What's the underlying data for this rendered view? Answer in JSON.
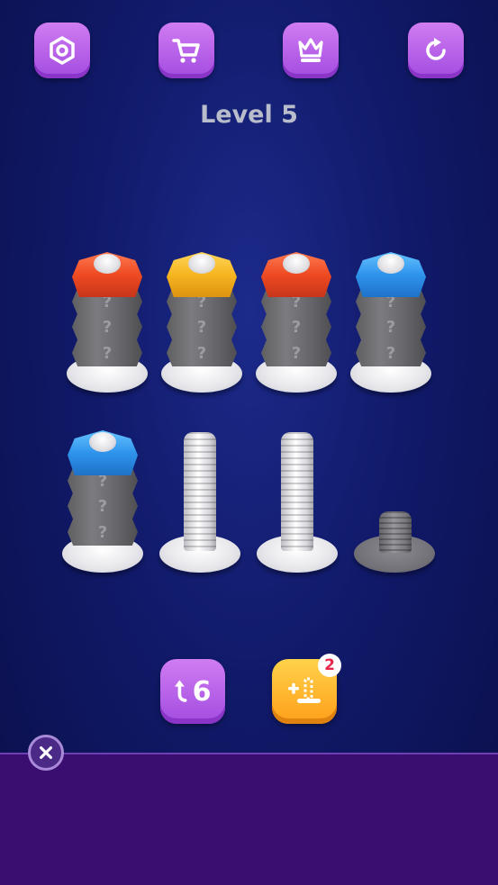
{
  "toolbar": {
    "buttons": [
      {
        "name": "settings",
        "icon": "hex-nut-icon"
      },
      {
        "name": "shop",
        "icon": "cart-icon"
      },
      {
        "name": "crown",
        "icon": "crown-icon"
      },
      {
        "name": "restart",
        "icon": "refresh-icon"
      }
    ]
  },
  "level": {
    "title": "Level 5"
  },
  "board": {
    "hidden_mark": "?",
    "rows": [
      [
        {
          "top": "red",
          "hidden": 3
        },
        {
          "top": "yellow",
          "hidden": 3
        },
        {
          "top": "red",
          "hidden": 3
        },
        {
          "top": "blue",
          "hidden": 3
        }
      ],
      [
        {
          "top": "blue",
          "hidden": 3
        },
        {
          "top": "empty"
        },
        {
          "top": "empty"
        },
        {
          "top": "locked"
        }
      ]
    ],
    "colors": {
      "red": "#ee4a22",
      "yellow": "#f7b520",
      "blue": "#2f93ec"
    }
  },
  "actions": {
    "undo_count": "6",
    "add_bolt_badge": "2"
  },
  "ad": {
    "close_icon": "close-icon"
  }
}
